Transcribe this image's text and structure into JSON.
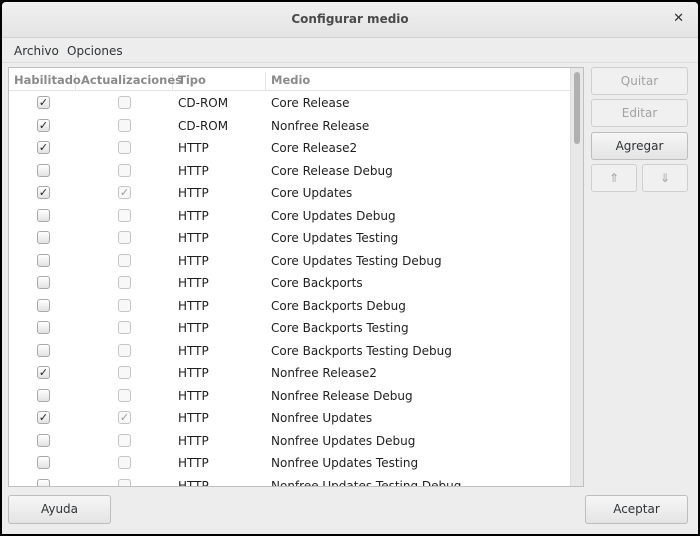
{
  "window": {
    "title": "Configurar medio",
    "close_icon": "close-icon"
  },
  "menu": [
    "Archivo",
    "Opciones"
  ],
  "columns": [
    "Habilitado",
    "Actualizaciones",
    "Tipo",
    "Medio"
  ],
  "rows": [
    {
      "enabled": true,
      "updates": false,
      "type": "CD-ROM",
      "medium": "Core Release"
    },
    {
      "enabled": true,
      "updates": false,
      "type": "CD-ROM",
      "medium": "Nonfree Release"
    },
    {
      "enabled": true,
      "updates": false,
      "type": "HTTP",
      "medium": "Core Release2"
    },
    {
      "enabled": false,
      "updates": false,
      "type": "HTTP",
      "medium": "Core Release Debug"
    },
    {
      "enabled": true,
      "updates": true,
      "type": "HTTP",
      "medium": "Core Updates"
    },
    {
      "enabled": false,
      "updates": false,
      "type": "HTTP",
      "medium": "Core Updates Debug"
    },
    {
      "enabled": false,
      "updates": false,
      "type": "HTTP",
      "medium": "Core Updates Testing"
    },
    {
      "enabled": false,
      "updates": false,
      "type": "HTTP",
      "medium": "Core Updates Testing Debug"
    },
    {
      "enabled": false,
      "updates": false,
      "type": "HTTP",
      "medium": "Core Backports"
    },
    {
      "enabled": false,
      "updates": false,
      "type": "HTTP",
      "medium": "Core Backports Debug"
    },
    {
      "enabled": false,
      "updates": false,
      "type": "HTTP",
      "medium": "Core Backports Testing"
    },
    {
      "enabled": false,
      "updates": false,
      "type": "HTTP",
      "medium": "Core Backports Testing Debug"
    },
    {
      "enabled": true,
      "updates": false,
      "type": "HTTP",
      "medium": "Nonfree Release2"
    },
    {
      "enabled": false,
      "updates": false,
      "type": "HTTP",
      "medium": "Nonfree Release Debug"
    },
    {
      "enabled": true,
      "updates": true,
      "type": "HTTP",
      "medium": "Nonfree Updates"
    },
    {
      "enabled": false,
      "updates": false,
      "type": "HTTP",
      "medium": "Nonfree Updates Debug"
    },
    {
      "enabled": false,
      "updates": false,
      "type": "HTTP",
      "medium": "Nonfree Updates Testing"
    },
    {
      "enabled": false,
      "updates": false,
      "type": "HTTP",
      "medium": "Nonfree Updates Testing Debug"
    }
  ],
  "side_buttons": {
    "remove": "Quitar",
    "edit": "Editar",
    "add": "Agregar",
    "up_icon": "move-up-icon",
    "down_icon": "move-down-icon"
  },
  "footer": {
    "help": "Ayuda",
    "ok": "Aceptar"
  }
}
